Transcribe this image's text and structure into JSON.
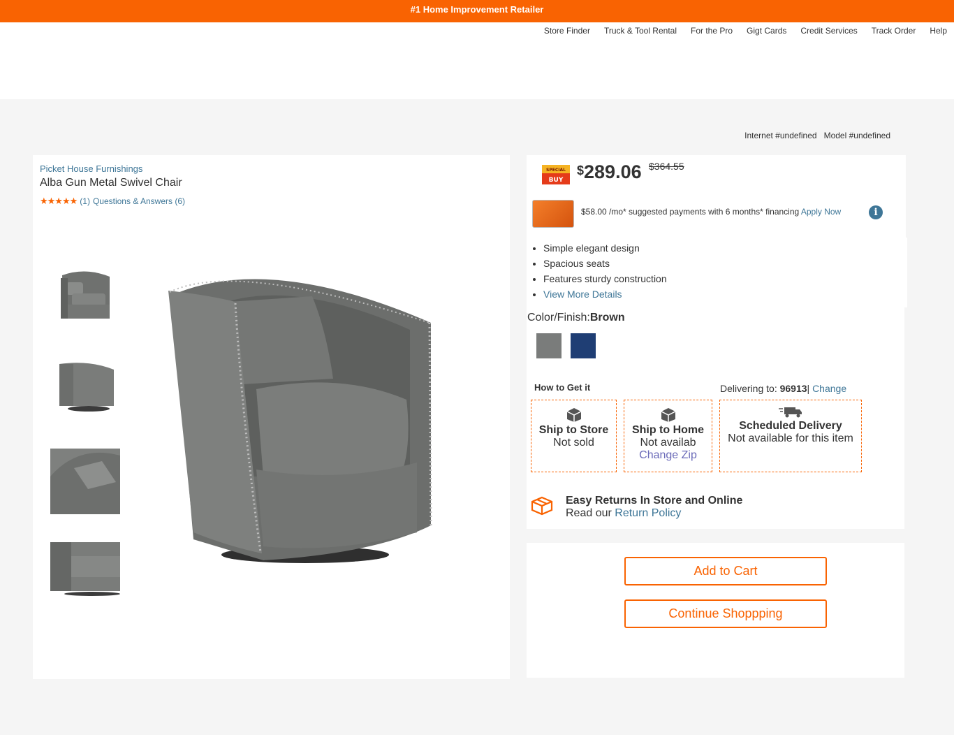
{
  "topbar": {
    "text": "#1 Home Improvement Retailer"
  },
  "utility_nav": [
    "Store Finder",
    "Truck & Tool Rental",
    "For the Pro",
    "Gigt Cards",
    "Credit Services",
    "Track Order",
    "Help"
  ],
  "identifiers": {
    "internet": "Internet #undefined",
    "model": "Model #undefined"
  },
  "product": {
    "brand": "Picket House Furnishings",
    "title": "Alba Gun Metal Swivel Chair",
    "rating_stars": "★★★★★",
    "rating_value": 4.5,
    "review_count": "(1)",
    "qa_link": "Questions & Answers (6)"
  },
  "pricing": {
    "badge_text": "SPECIAL BUY",
    "currency": "$",
    "price": "289.06",
    "was_price": "$364.55",
    "financing_text": "$58.00 /mo* suggested payments with 6 months* financing",
    "apply_link": "Apply Now",
    "info_icon": "i"
  },
  "highlights": [
    "Simple elegant design",
    "Spacious seats",
    "Features sturdy construction"
  ],
  "view_more": "View More Details",
  "color": {
    "label": "Color/Finish:",
    "value": "Brown",
    "swatches": [
      "#7a7c7b",
      "#1f3e74"
    ]
  },
  "fulfillment": {
    "heading": "How to Get it",
    "delivering_label": "Delivering to:",
    "zip": "96913",
    "separator": "|",
    "change_link": "Change",
    "options": [
      {
        "name": "Ship to Store",
        "status": "Not sold",
        "link": ""
      },
      {
        "name": "Ship to Home",
        "status": "Not availab",
        "link": "Change Zip"
      },
      {
        "name": "Scheduled Delivery",
        "status": "Not available for this item",
        "link": ""
      }
    ]
  },
  "returns": {
    "title": "Easy Returns In Store and Online",
    "prefix": "Read our",
    "link": "Return Policy"
  },
  "actions": {
    "add_to_cart": "Add to Cart",
    "continue": "Continue Shoppping"
  },
  "colors": {
    "brand_orange": "#f96302",
    "link_blue": "#3e7697"
  }
}
